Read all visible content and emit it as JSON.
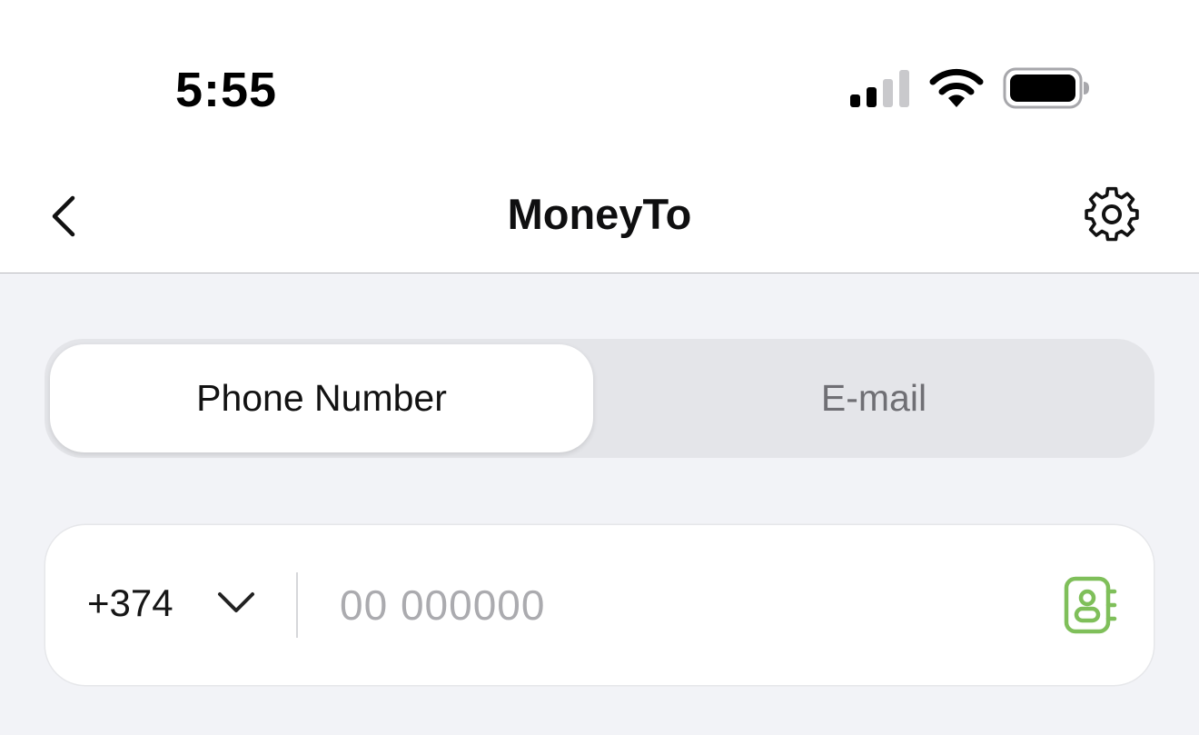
{
  "status_bar": {
    "time": "5:55",
    "signal_icon": "cellular-signal-icon",
    "wifi_icon": "wifi-icon",
    "battery_icon": "battery-icon"
  },
  "nav": {
    "title": "MoneyTo",
    "back_icon": "chevron-left-icon",
    "settings_icon": "gear-icon"
  },
  "segmented": {
    "options": [
      "Phone Number",
      "E-mail"
    ],
    "selected": "Phone Number"
  },
  "phone": {
    "country_code": "+374",
    "placeholder": "00 000000",
    "value": "",
    "contacts_icon": "contacts-book-icon"
  },
  "colors": {
    "accent_green": "#7fbf5a",
    "background": "#f2f3f7"
  }
}
